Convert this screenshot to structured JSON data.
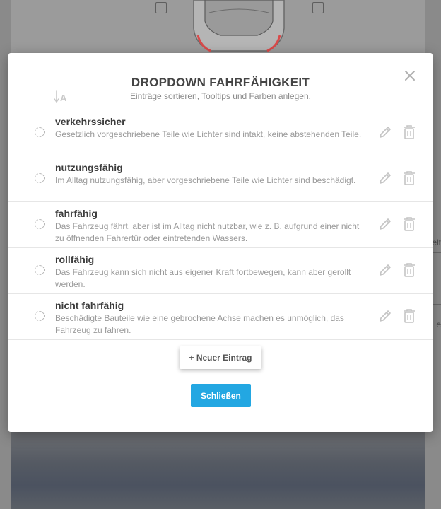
{
  "modal": {
    "title": "DROPDOWN FAHRFÄHIGKEIT",
    "subtitle": "Einträge sortieren, Tooltips und Farben anlegen.",
    "entries": [
      {
        "title": "verkehrssicher",
        "description": "Gesetzlich vorgeschriebene Teile wie Lichter sind intakt, keine abstehenden Teile."
      },
      {
        "title": "nutzungsfähig",
        "description": "Im Alltag nutzungsfähig, aber vorgeschriebene Teile wie Lichter sind beschädigt."
      },
      {
        "title": "fahrfähig",
        "description": "Das Fahrzeug fährt, aber ist im Alltag nicht nutzbar, wie z. B. aufgrund einer nicht zu öffnenden Fahrertür oder eintretenden Wassers."
      },
      {
        "title": "rollfähig",
        "description": "Das Fahrzeug kann sich nicht aus eigener Kraft fortbewegen, kann aber gerollt werden."
      },
      {
        "title": "nicht fahrfähig",
        "description": "Beschädigte Bauteile wie eine gebrochene Achse machen es unmöglich, das Fahrzeug zu fahren."
      }
    ],
    "add_button_label": "+ Neuer Eintrag",
    "close_button_label": "Schließen"
  },
  "background": {
    "right_edge_texts": [
      "elt",
      "e"
    ]
  },
  "colors": {
    "primary": "#23a7e2",
    "overlay": "#8a8a8a",
    "car_accent": "#d94a4a"
  },
  "icons": {
    "sort": "sort-alpha-icon",
    "close": "close-icon",
    "edit": "pencil-icon",
    "delete": "trash-icon",
    "radio": "radio-icon"
  }
}
